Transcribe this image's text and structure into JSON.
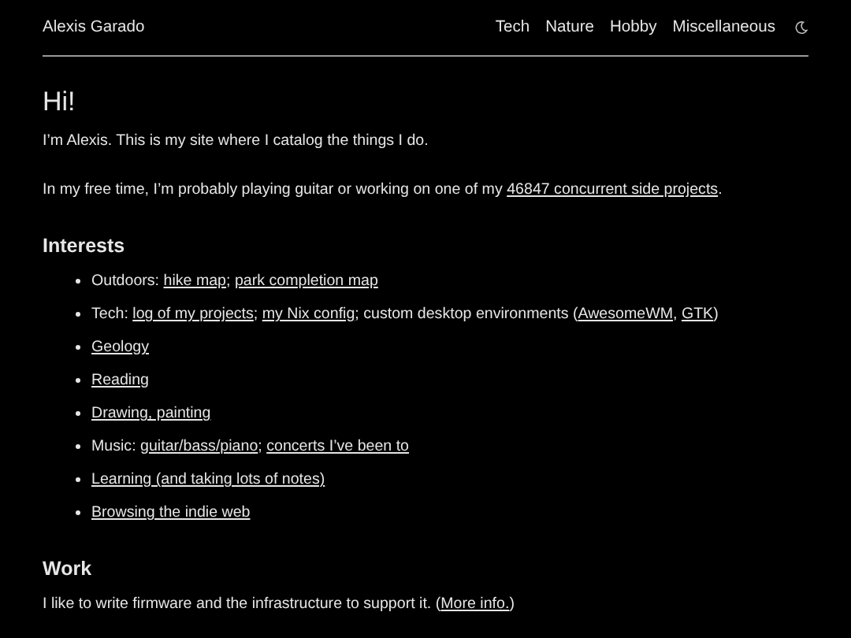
{
  "header": {
    "site_title": "Alexis Garado",
    "nav": [
      {
        "label": "Tech"
      },
      {
        "label": "Nature"
      },
      {
        "label": "Hobby"
      },
      {
        "label": "Miscellaneous"
      }
    ]
  },
  "heading": "Hi!",
  "intro": [
    [
      {
        "text": "I’m Alexis. This is my site where I catalog the things I do.",
        "link": false
      }
    ],
    [
      {
        "text": "In my free time, I’m probably playing guitar or working on one of my ",
        "link": false
      },
      {
        "text": "46847 concurrent side projects",
        "link": true
      },
      {
        "text": ".",
        "link": false
      }
    ]
  ],
  "interests": {
    "title": "Interests",
    "items": [
      [
        {
          "text": "Outdoors: ",
          "link": false
        },
        {
          "text": "hike map",
          "link": true
        },
        {
          "text": "; ",
          "link": false
        },
        {
          "text": "park completion map",
          "link": true
        }
      ],
      [
        {
          "text": "Tech: ",
          "link": false
        },
        {
          "text": "log of my projects",
          "link": true
        },
        {
          "text": "; ",
          "link": false
        },
        {
          "text": "my Nix config",
          "link": true
        },
        {
          "text": "; custom desktop environments (",
          "link": false
        },
        {
          "text": "AwesomeWM",
          "link": true
        },
        {
          "text": ", ",
          "link": false
        },
        {
          "text": "GTK",
          "link": true
        },
        {
          "text": ")",
          "link": false
        }
      ],
      [
        {
          "text": "Geology",
          "link": true
        }
      ],
      [
        {
          "text": "Reading",
          "link": true
        }
      ],
      [
        {
          "text": "Drawing, painting",
          "link": true
        }
      ],
      [
        {
          "text": "Music: ",
          "link": false
        },
        {
          "text": "guitar/bass/piano",
          "link": true
        },
        {
          "text": "; ",
          "link": false
        },
        {
          "text": "concerts I’ve been to",
          "link": true
        }
      ],
      [
        {
          "text": "Learning (and taking lots of notes)",
          "link": true
        }
      ],
      [
        {
          "text": "Browsing the indie web",
          "link": true
        }
      ]
    ]
  },
  "work": {
    "title": "Work",
    "paragraph": [
      {
        "text": "I like to write firmware and the infrastructure to support it. (",
        "link": false
      },
      {
        "text": "More info.",
        "link": true
      },
      {
        "text": ")",
        "link": false
      }
    ]
  }
}
